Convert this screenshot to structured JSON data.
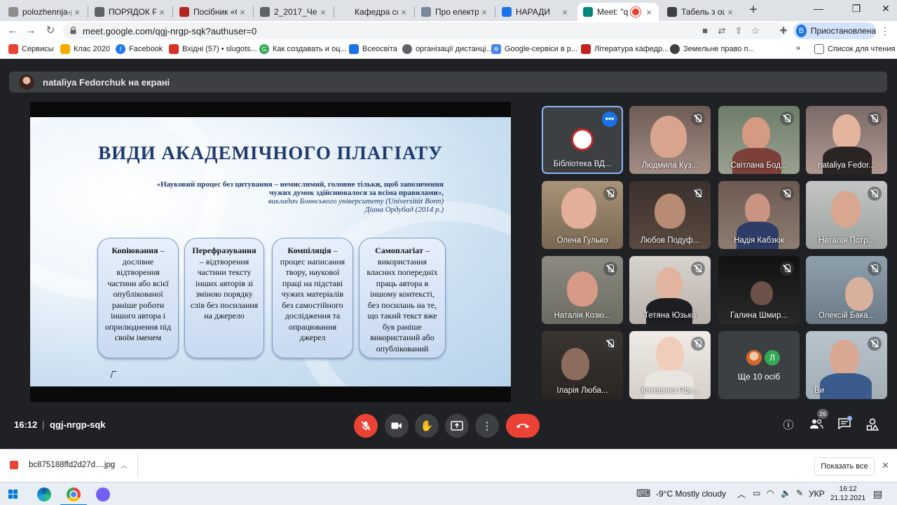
{
  "browser": {
    "tabs": [
      {
        "title": "polozhennja-p",
        "color": "#8e8e8e"
      },
      {
        "title": "ПОРЯДОК РО",
        "color": "#5f6368"
      },
      {
        "title": "Посібник «Св",
        "color": "#b3261e"
      },
      {
        "title": "2_2017_Черн",
        "color": "#5f6368"
      },
      {
        "title": "Кафедра соці",
        "color": "#1a73e8"
      },
      {
        "title": "Про електрон",
        "color": "#7b8794"
      },
      {
        "title": "НАРАДИ",
        "color": "#1a73e8"
      },
      {
        "title": "Meet: \"q",
        "color": "#00897b",
        "active": true
      },
      {
        "title": "Табель з оці",
        "color": "#3c4043"
      }
    ],
    "url": "meet.google.com/qgj-nrgp-sqk?authuser=0",
    "profile_initial": "B",
    "profile_label": "Приостановлена",
    "bookmarks": [
      {
        "label": "Сервисы",
        "color": "#ea4335"
      },
      {
        "label": "Клас 2020",
        "color": "#f9ab00"
      },
      {
        "label": "Facebook",
        "color": "#1877f2"
      },
      {
        "label": "Вхідні (57) • slugots...",
        "color": "#d93025"
      },
      {
        "label": "Как создавать и оц...",
        "color": "#34a853"
      },
      {
        "label": "Всеосвіта",
        "color": "#1a73e8"
      },
      {
        "label": "організації дистанці...",
        "color": "#5f6368"
      },
      {
        "label": "Google-сервіси в р...",
        "color": "#4285f4"
      },
      {
        "label": "Література кафедр...",
        "color": "#c5221f"
      },
      {
        "label": "Земельне право п...",
        "color": "#3c4043"
      }
    ],
    "reading_list": "Список для чтения"
  },
  "meet": {
    "presenter": "nataliya Fedorchuk на екрані",
    "slide": {
      "title": "ВИДИ АКАДЕМІЧНОГО ПЛАГІАТУ",
      "quote_line1": "«Науковий процес без цитування – немислимий, головне тільки, щоб запозичення",
      "quote_line2": "чужих думок здійснювалося за всіма правилами»,",
      "quote_line3": "викладач Боннського університету (Universität Bonn)",
      "quote_line4": "Діана Ордубад (2014 р.)",
      "boxes": [
        {
          "head": "Копіювання",
          "text": "– дослівне відтворення частини або всієї опублікованої раніше роботи іншого автора і оприлюднення під своїм іменем"
        },
        {
          "head": "Перефразування",
          "text": "– відтворення частини тексту інших авторів зі зміною порядку слів без посилання на джерело"
        },
        {
          "head": "Компіляція",
          "text": "– процес написання твору, наукової праці на підставі чужих матеріалів без самостійного дослідження та опрацювання джерел"
        },
        {
          "head": "Самоплагіат",
          "text": "– використання власних попередніх праць автора в іншому контексті, без посилань на те, що такий текст вже був раніше використаний або опублікований"
        }
      ]
    },
    "participants": [
      "Бібліотека ВД...",
      "Людмила Куз...",
      "Світлана Бод...",
      "nataliya Fedor...",
      "Олена Гулько",
      "Любов Подуф...",
      "Надія Кабзюк",
      "Наталія Потр...",
      "Наталія Козю...",
      "Тетяна Юзько",
      "Галина Шмир...",
      "Олексій Бака...",
      "Іларія Люба...",
      "Катерина Пру...",
      "Ви"
    ],
    "more_label": "Ще 10 осіб",
    "more_initial": "Л",
    "time": "16:12",
    "meeting_code": "qgj-nrgp-sqk",
    "people_count": "26"
  },
  "downloads": {
    "file": "bc875188ffd2d27d....jpg",
    "show_all": "Показать все"
  },
  "taskbar": {
    "weather": "-9°C  Mostly cloudy",
    "lang": "УКР",
    "time": "16:12",
    "date": "21.12.2021"
  }
}
